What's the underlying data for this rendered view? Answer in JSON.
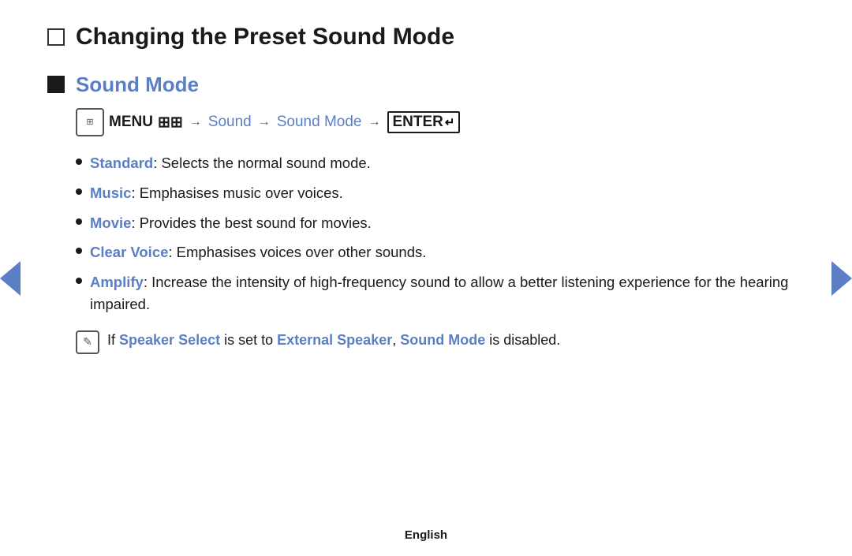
{
  "page": {
    "title": "Changing the Preset Sound Mode",
    "section": {
      "title": "Sound Mode",
      "menu_path": {
        "menu_label": "MENU",
        "sound_label": "Sound",
        "sound_mode_label": "Sound Mode",
        "enter_label": "ENTER"
      },
      "bullets": [
        {
          "term": "Standard",
          "description": ": Selects the normal sound mode."
        },
        {
          "term": "Music",
          "description": ": Emphasises music over voices."
        },
        {
          "term": "Movie",
          "description": ": Provides the best sound for movies."
        },
        {
          "term": "Clear Voice",
          "description": ": Emphasises voices over other sounds."
        },
        {
          "term": "Amplify",
          "description": ": Increase the intensity of high-frequency sound to allow a better listening experience for the hearing impaired."
        }
      ],
      "note": {
        "prefix": "If ",
        "term1": "Speaker Select",
        "middle": " is set to ",
        "term2": "External Speaker",
        "separator": ", ",
        "term3": "Sound Mode",
        "suffix": " is disabled."
      }
    },
    "footer": "English"
  }
}
